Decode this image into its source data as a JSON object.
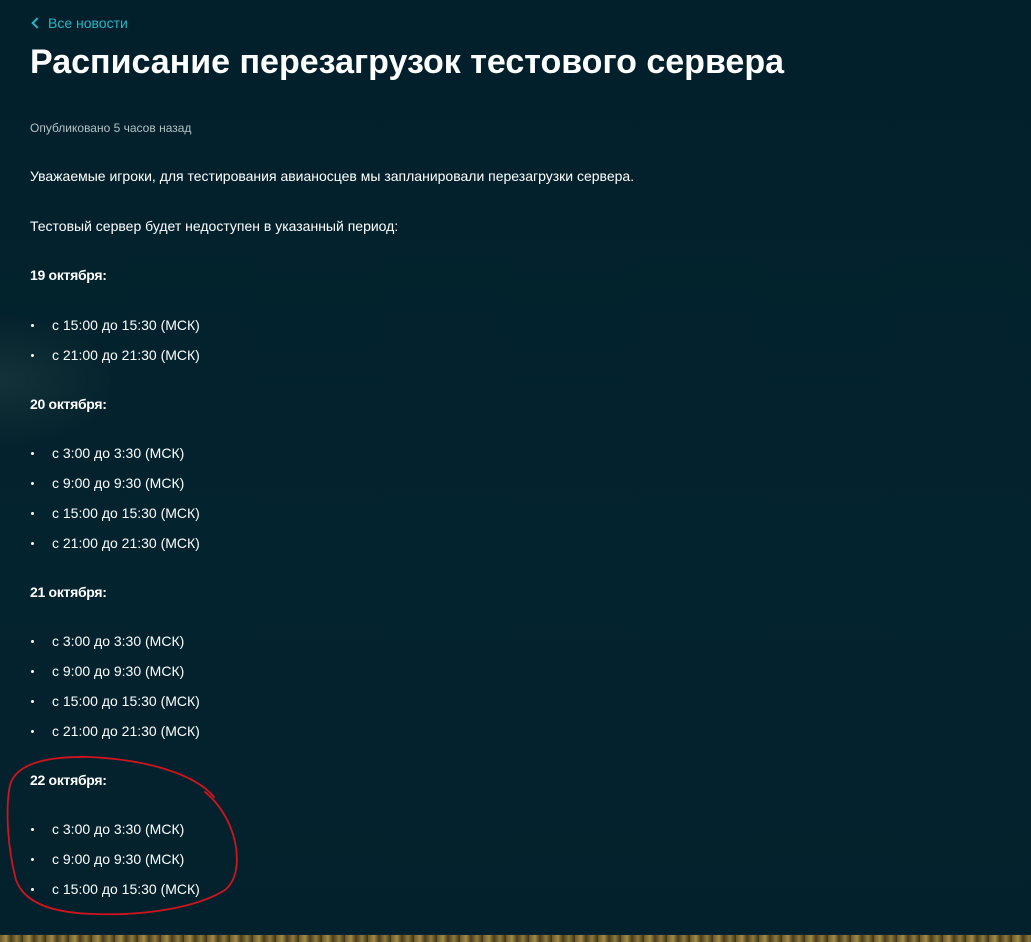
{
  "nav": {
    "back_label": "Все новости"
  },
  "article": {
    "title": "Расписание перезагрузок тестового сервера",
    "published": "Опубликовано 5 часов назад",
    "intro": "Уважаемые игроки, для тестирования авианосцев мы запланировали перезагрузки сервера.",
    "note": "Тестовый сервер будет недоступен в указанный период:",
    "schedule": [
      {
        "date": "19 октября:",
        "slots": [
          "с 15:00 до 15:30 (МСК)",
          "с 21:00 до 21:30 (МСК)"
        ]
      },
      {
        "date": "20 октября:",
        "slots": [
          "с 3:00 до 3:30 (МСК)",
          "с 9:00 до 9:30 (МСК)",
          "с 15:00 до 15:30 (МСК)",
          "с 21:00 до 21:30 (МСК)"
        ]
      },
      {
        "date": "21 октября:",
        "slots": [
          "с 3:00 до 3:30 (МСК)",
          "с 9:00 до 9:30 (МСК)",
          "с 15:00 до 15:30 (МСК)",
          "с 21:00 до 21:30 (МСК)"
        ]
      },
      {
        "date": "22 октября:",
        "slots": [
          "с 3:00 до 3:30 (МСК)",
          "с 9:00 до 9:30 (МСК)",
          "с 15:00 до 15:30 (МСК)"
        ]
      }
    ]
  },
  "colors": {
    "background": "#03212c",
    "link": "#21b7c7",
    "annotation": "#d0141e"
  }
}
